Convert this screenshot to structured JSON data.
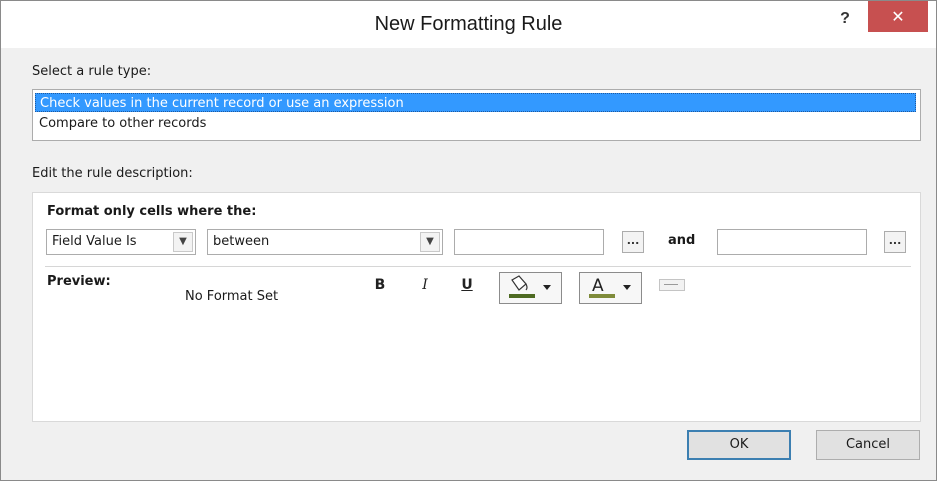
{
  "dialog": {
    "title": "New Formatting Rule",
    "help_label": "?",
    "close_label": "✕"
  },
  "rule_type": {
    "label": "Select a rule type:",
    "items": [
      "Check values in the current record or use an expression",
      "Compare to other records"
    ],
    "selected_index": 0
  },
  "description": {
    "label": "Edit the rule description:",
    "format_label": "Format only cells where the:",
    "condition_combo": "Field Value Is",
    "operator_combo": "between",
    "value1": "",
    "value2": "",
    "ellipsis": "...",
    "and_label": "and"
  },
  "preview": {
    "label": "Preview:",
    "text": "No Format Set",
    "bold": "B",
    "italic": "I",
    "underline": "U",
    "font_color_glyph": "A",
    "fill_color": "#4e6a22",
    "font_color": "#7f8b3a"
  },
  "buttons": {
    "ok": "OK",
    "cancel": "Cancel"
  },
  "colors": {
    "selection": "#3399ff",
    "close": "#c75050"
  }
}
